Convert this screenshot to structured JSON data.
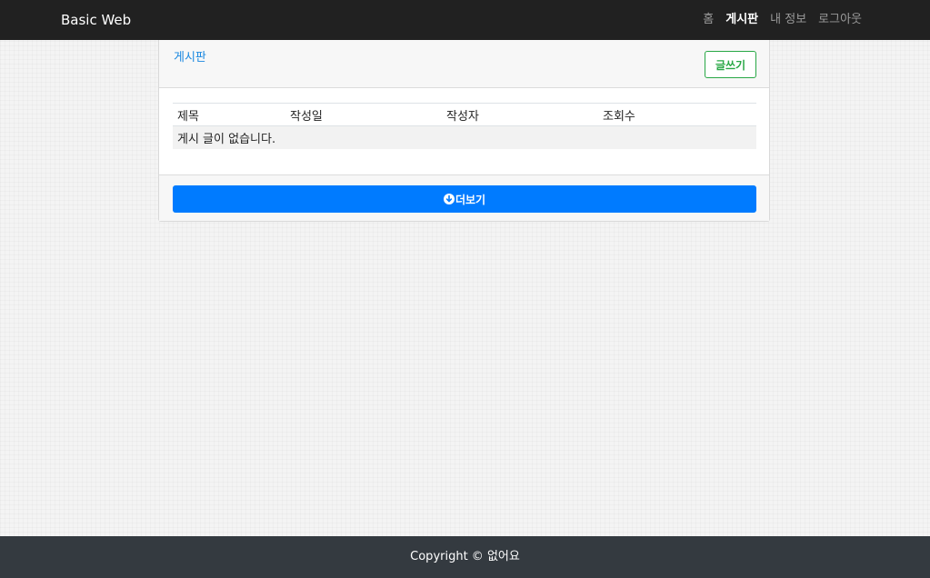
{
  "navbar": {
    "brand": "Basic Web",
    "links": [
      {
        "label": "홈",
        "active": false
      },
      {
        "label": "게시판",
        "active": true
      },
      {
        "label": "내 정보",
        "active": false
      },
      {
        "label": "로그아웃",
        "active": false
      }
    ]
  },
  "board": {
    "title": "게시판",
    "write_label": "글쓰기",
    "columns": [
      "제목",
      "작성일",
      "작성자",
      "조회수"
    ],
    "empty_message": "게시 글이 없습니다.",
    "more_label": "더보기",
    "more_icon": "arrow-circle-down-icon"
  },
  "footer": {
    "text": "Copyright © 없어요"
  },
  "colors": {
    "navbar_bg": "#212121",
    "footer_bg": "#343a40",
    "primary": "#007bff",
    "success": "#28a745",
    "link": "#1a88e0"
  }
}
